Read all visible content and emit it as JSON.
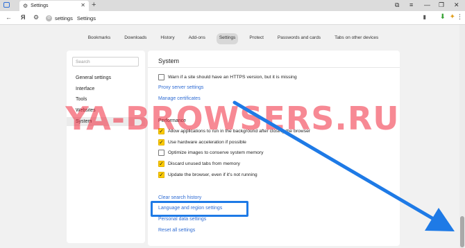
{
  "tab": {
    "title": "Settings"
  },
  "address": {
    "url_host": "settings",
    "url_title": "Settings"
  },
  "topnav": {
    "items": [
      "Bookmarks",
      "Downloads",
      "History",
      "Add-ons",
      "Settings",
      "Protect",
      "Passwords and cards",
      "Tabs on other devices"
    ],
    "active": "Settings"
  },
  "sidebar": {
    "search_placeholder": "Search",
    "items": [
      "General settings",
      "Interface",
      "Tools",
      "Websites",
      "System"
    ],
    "active": "System"
  },
  "main": {
    "title": "System",
    "https_warn": {
      "label": "Warn if a site should have an HTTPS version, but it is missing",
      "checked": false
    },
    "proxy_link": "Proxy server settings",
    "certs_link": "Manage certificates",
    "performance_title": "Performance",
    "performance_options": [
      {
        "label": "Allow applications to run in the background after closing the browser",
        "checked": true
      },
      {
        "label": "Use hardware acceleration if possible",
        "checked": true
      },
      {
        "label": "Optimize images to conserve system memory",
        "checked": false
      },
      {
        "label": "Discard unused tabs from memory",
        "checked": true
      },
      {
        "label": "Update the browser, even if it's not running",
        "checked": true
      }
    ],
    "clear_history_link": "Clear search history",
    "language_link": "Language and region settings",
    "personal_link": "Personal data settings",
    "reset_link": "Reset all settings"
  },
  "watermark": "YA-BROWSERS.RU",
  "colors": {
    "accent_link": "#2f6cd3",
    "checkbox_on": "#ffcc00",
    "highlight": "#1e7ae6",
    "watermark": "#f0283c"
  },
  "icons": {
    "gear": "gear-icon",
    "close": "close-icon",
    "plus": "new-tab-icon",
    "back": "back-arrow-icon",
    "download": "download-icon",
    "bookmark": "bookmark-icon"
  }
}
